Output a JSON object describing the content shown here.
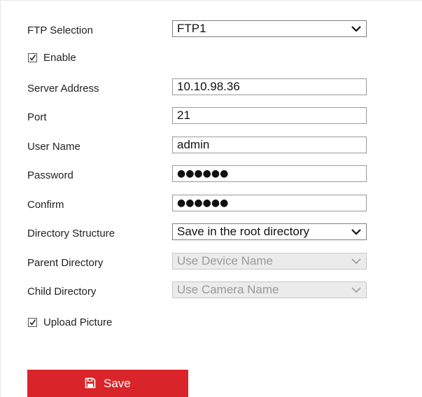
{
  "form": {
    "ftp_selection": {
      "label": "FTP Selection",
      "value": "FTP1"
    },
    "enable": {
      "label": "Enable",
      "checked": true
    },
    "server_address": {
      "label": "Server Address",
      "value": "10.10.98.36"
    },
    "port": {
      "label": "Port",
      "value": "21"
    },
    "user_name": {
      "label": "User Name",
      "value": "admin"
    },
    "password": {
      "label": "Password",
      "value": "●●●●●●"
    },
    "confirm": {
      "label": "Confirm",
      "value": "●●●●●●"
    },
    "directory_structure": {
      "label": "Directory Structure",
      "value": "Save in the root directory"
    },
    "parent_directory": {
      "label": "Parent Directory",
      "value": "Use Device Name",
      "disabled": true
    },
    "child_directory": {
      "label": "Child Directory",
      "value": "Use Camera Name",
      "disabled": true
    },
    "upload_picture": {
      "label": "Upload Picture",
      "checked": true
    }
  },
  "actions": {
    "save_label": "Save"
  },
  "icons": {
    "dropdown": "chevron-down-icon",
    "checkbox": "checkmark-icon",
    "save": "floppy-disk-icon"
  },
  "colors": {
    "accent": "#d9252a",
    "disabled_bg": "#ebebeb",
    "disabled_text": "#9a9a9a"
  }
}
